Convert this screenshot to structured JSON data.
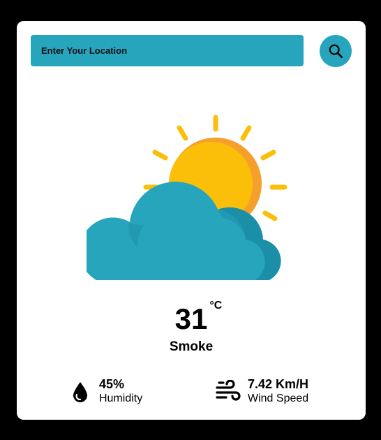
{
  "search": {
    "placeholder": "Enter Your Location"
  },
  "icons": {
    "search": "search-icon",
    "weather": "sun-behind-cloud-icon",
    "humidity": "water-drop-icon",
    "wind": "wind-icon"
  },
  "weather": {
    "temperature": "31",
    "unit": "°C",
    "condition": "Smoke"
  },
  "stats": {
    "humidity": {
      "value": "45%",
      "label": "Humidity"
    },
    "wind": {
      "value": "7.42 Km/H",
      "label": "Wind Speed"
    }
  },
  "colors": {
    "accent": "#26a5bd",
    "sun": "#fbbf0a",
    "sun_shade": "#f5a02b",
    "cloud_shade": "#1c8fa8"
  }
}
